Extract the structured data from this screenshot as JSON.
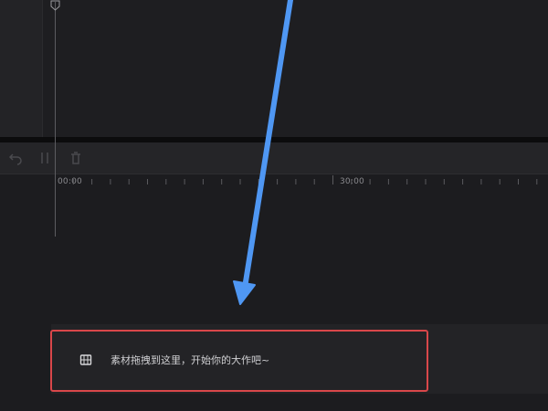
{
  "toolbar": {
    "tools": [
      {
        "icon": "undo-icon"
      },
      {
        "icon": "split-icon"
      },
      {
        "icon": "delete-icon"
      }
    ]
  },
  "timeline": {
    "ruler_labels": [
      "00:00",
      "30:00"
    ]
  },
  "track": {
    "icon": "film-strip-icon",
    "hint": "素材拖拽到这里，开始你的大作吧~"
  },
  "colors": {
    "highlight_box": "#d9474a",
    "annotation_arrow": "#4f97f3",
    "background": "#1c1c1f"
  }
}
